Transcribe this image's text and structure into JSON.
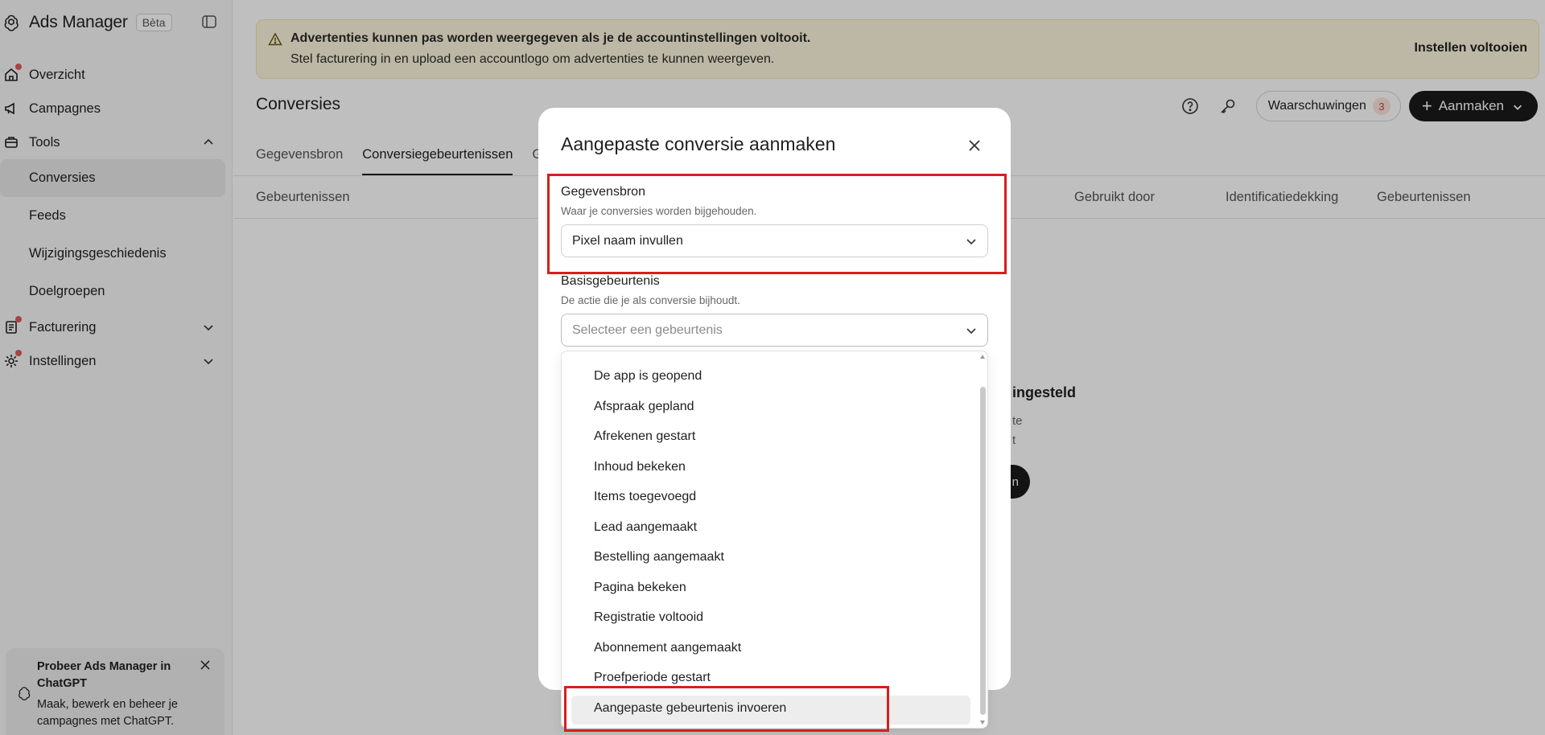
{
  "app": {
    "name": "Ads Manager",
    "badge": "Bèta"
  },
  "sidebar": {
    "items": [
      {
        "label": "Overzicht"
      },
      {
        "label": "Campagnes"
      },
      {
        "label": "Tools"
      },
      {
        "label": "Facturering"
      },
      {
        "label": "Instellingen"
      }
    ],
    "tools_sub": [
      {
        "label": "Conversies"
      },
      {
        "label": "Feeds"
      },
      {
        "label": "Wijzigingsgeschiedenis"
      },
      {
        "label": "Doelgroepen"
      }
    ],
    "promo": {
      "title": "Probeer Ads Manager in ChatGPT",
      "text": "Maak, bewerk en beheer je campagnes met ChatGPT."
    }
  },
  "banner": {
    "title": "Advertenties kunnen pas worden weergegeven als je de accountinstellingen voltooit.",
    "text": "Stel facturering in en upload een accountlogo om advertenties te kunnen weergeven.",
    "action": "Instellen voltooien"
  },
  "header": {
    "title": "Conversies",
    "warnings_label": "Waarschuwingen",
    "warnings_count": "3",
    "create_label": "Aanmaken"
  },
  "tabs": [
    {
      "label": "Gegevensbron"
    },
    {
      "label": "Conversiegebeurtenissen"
    },
    {
      "label": "G"
    }
  ],
  "columns": {
    "c1": "Gebeurtenissen",
    "c2": "Gebruikt door",
    "c3": "Identificatiedekking",
    "c4": "Gebeurtenissen"
  },
  "empty_state": {
    "title": "ingesteld",
    "frag1": "te",
    "frag2": "t",
    "button_frag": "n"
  },
  "modal": {
    "title": "Aangepaste conversie aanmaken",
    "source": {
      "label": "Gegevensbron",
      "desc": "Waar je conversies worden bijgehouden.",
      "value": "Pixel naam invullen"
    },
    "base_event": {
      "label": "Basisgebeurtenis",
      "desc": "De actie die je als conversie bijhoudt.",
      "placeholder": "Selecteer een gebeurtenis"
    }
  },
  "dropdown": {
    "items": [
      "De app is geopend",
      "Afspraak gepland",
      "Afrekenen gestart",
      "Inhoud bekeken",
      "Items toegevoegd",
      "Lead aangemaakt",
      "Bestelling aangemaakt",
      "Pagina bekeken",
      "Registratie voltooid",
      "Abonnement aangemaakt",
      "Proefperiode gestart",
      "Aangepaste gebeurtenis invoeren"
    ]
  },
  "colors": {
    "highlight": "#d61f1f",
    "banner_bg": "#fbf6dc",
    "notification_dot": "#e05a5a",
    "primary_button": "#1a1a1a"
  }
}
